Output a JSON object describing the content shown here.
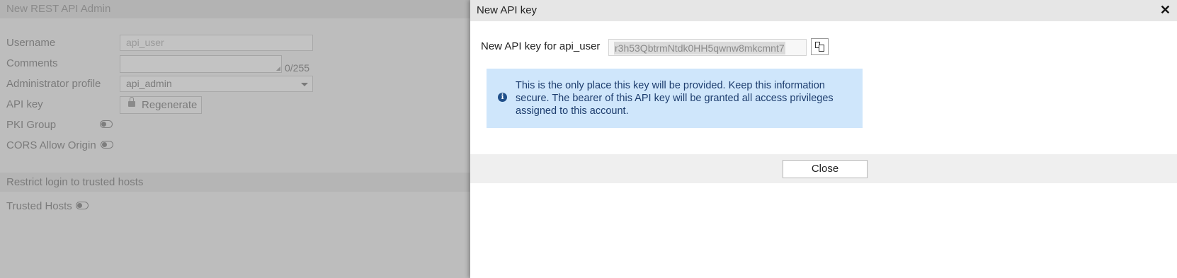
{
  "background": {
    "title": "New REST API Admin",
    "username": {
      "label": "Username",
      "placeholder": "api_user"
    },
    "comments": {
      "label": "Comments",
      "counter": "0/255"
    },
    "admin_profile": {
      "label": "Administrator profile",
      "value": "api_admin"
    },
    "api_key": {
      "label": "API key",
      "button": "Regenerate"
    },
    "pki_group": {
      "label": "PKI Group"
    },
    "cors": {
      "label": "CORS Allow Origin"
    },
    "restrict_section": "Restrict login to trusted hosts",
    "trusted_hosts": {
      "label": "Trusted Hosts"
    }
  },
  "dialog": {
    "title": "New API key",
    "key_label": "New API key for api_user",
    "key_value": "r3h53QbtrmNtdk0HH5qwnw8mkcmnt7",
    "info_text": "This is the only place this key will be provided. Keep this information secure. The bearer of this API key will be granted all access privileges assigned to this account.",
    "close_button": "Close"
  },
  "icons": [
    "close-icon",
    "copy-icon",
    "info-icon",
    "lock-icon",
    "dropdown-caret-icon"
  ]
}
